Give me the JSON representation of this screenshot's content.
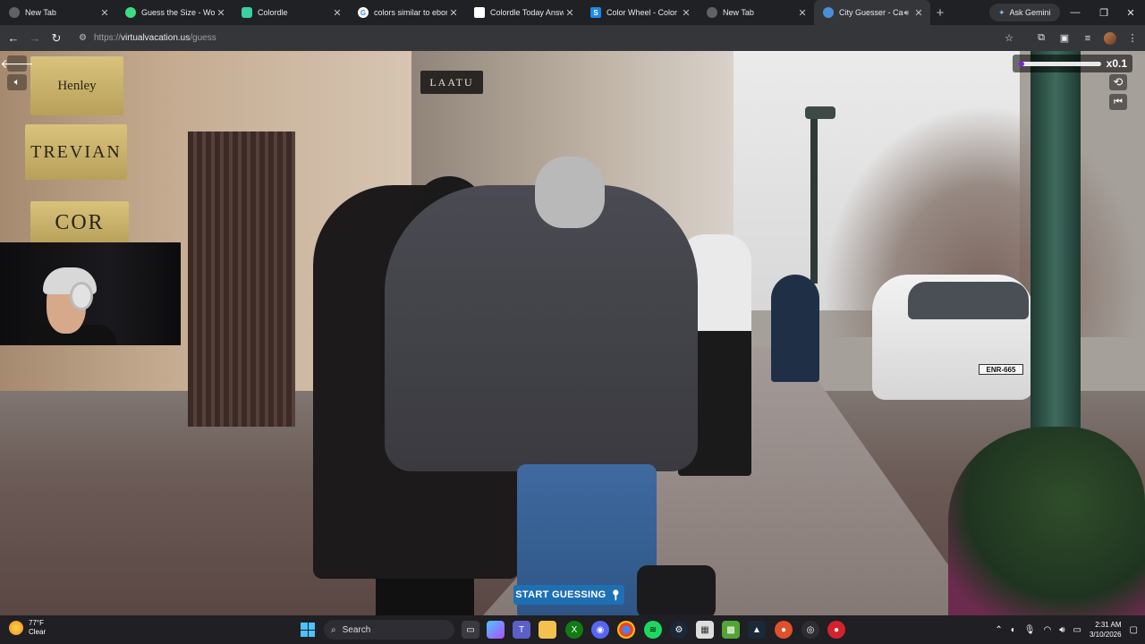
{
  "browser": {
    "tabs": [
      {
        "title": "New Tab",
        "favicon_color": "#5f6368",
        "active": false
      },
      {
        "title": "Guess the Size - Worldle",
        "favicon_color": "#3ddc84",
        "active": false
      },
      {
        "title": "Colordle",
        "favicon_color": "#3ccfa0",
        "active": false
      },
      {
        "title": "colors similar to ebony",
        "favicon_color": "#ffffff",
        "active": false
      },
      {
        "title": "Colordle Today Answer",
        "favicon_color": "#ffffff",
        "active": false
      },
      {
        "title": "Color Wheel - Color Ca",
        "favicon_color": "#1e88e5",
        "active": false
      },
      {
        "title": "New Tab",
        "favicon_color": "#5f6368",
        "active": false
      },
      {
        "title": "City Guesser - Can",
        "favicon_color": "#4a90d9",
        "active": true
      }
    ],
    "new_tab_label": "+",
    "ask_gemini_label": "Ask Gemini",
    "url_prefix": "https://",
    "url_host": "virtualvacation.us",
    "url_path": "/guess"
  },
  "game": {
    "speed_label": "x0.1",
    "speed_fraction": 0.08,
    "start_button_label": "START GUESSING",
    "accent_color": "#1f6fb4",
    "speed_color": "#7a2bbf"
  },
  "scene": {
    "sign_1": "Henley",
    "sign_2": "TREVIAN",
    "sign_3": "COR",
    "shop_sign": "LAATU",
    "plate": "ENR-665"
  },
  "taskbar": {
    "weather_temp": "77°F",
    "weather_desc": "Clear",
    "search_label": "Search",
    "time": "2:31 AM",
    "date": "3/10/2026"
  }
}
